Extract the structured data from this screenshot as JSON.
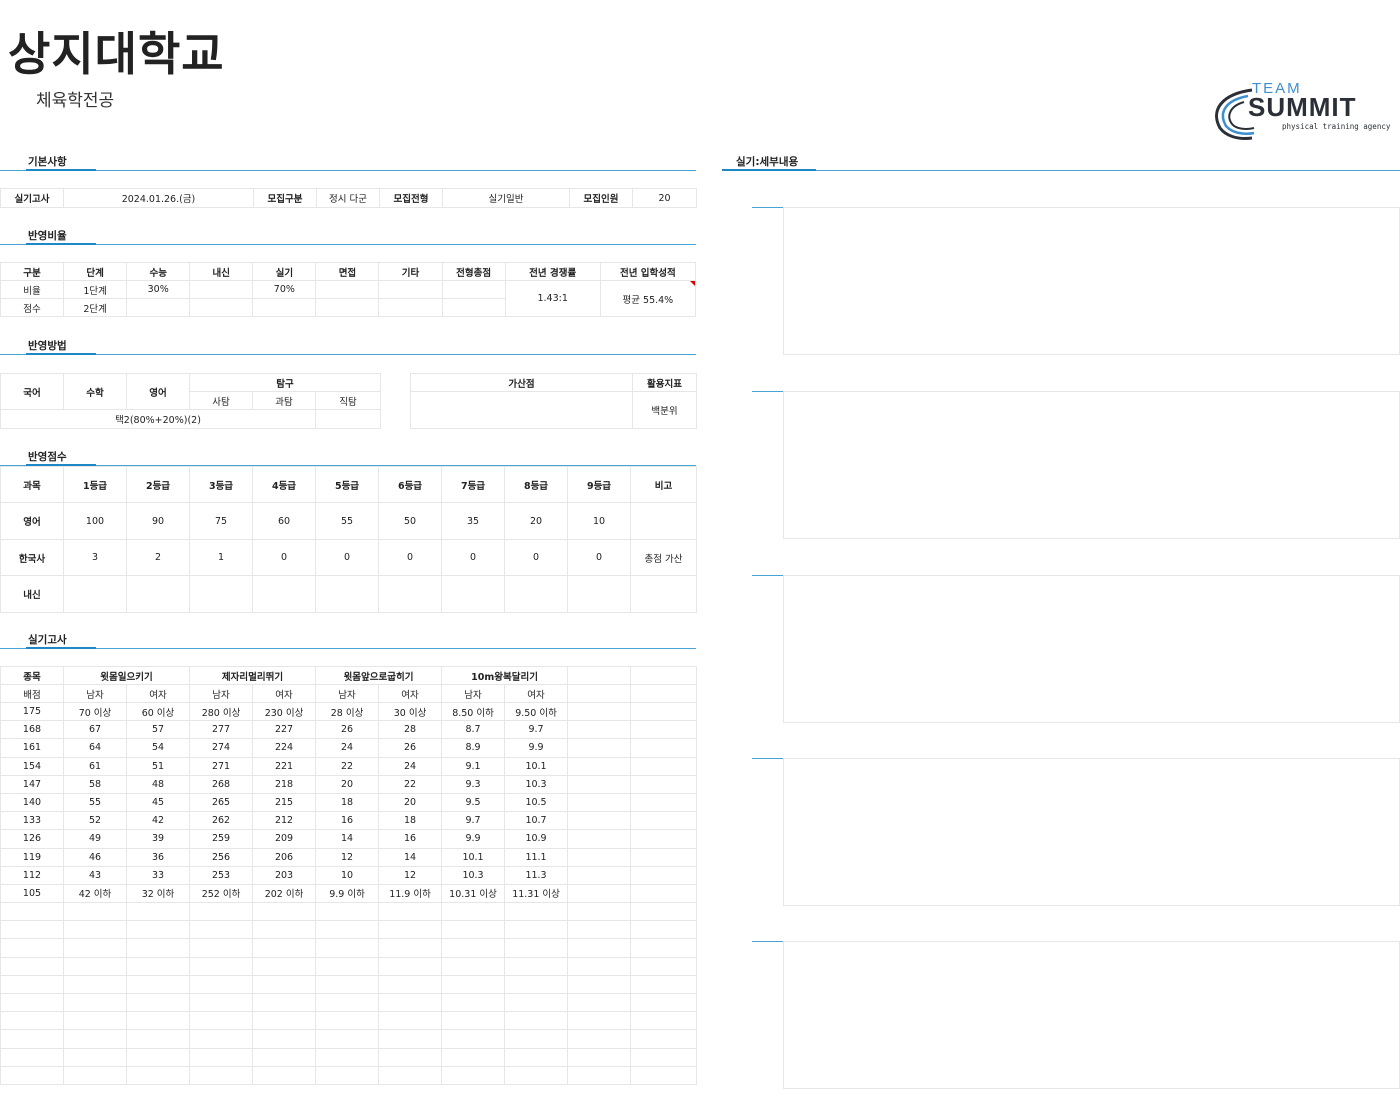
{
  "header": {
    "title": "상지대학교",
    "subtitle": "체육학전공",
    "logo": {
      "line1": "TEAM",
      "line2": "SUMMIT",
      "line3": "physical training agency"
    }
  },
  "sections": {
    "basic": "기본사항",
    "ratio": "반영비율",
    "method": "반영방법",
    "score": "반영점수",
    "practical": "실기고사",
    "detail": "실기:세부내용"
  },
  "basic": {
    "exam_label": "실기고사",
    "exam_date": "2024.01.26.(금)",
    "recruit_type_label": "모집구분",
    "recruit_type": "정시 다군",
    "admission_label": "모집전형",
    "admission": "실기일반",
    "quota_label": "모집인원",
    "quota": "20"
  },
  "ratio": {
    "headers": [
      "구분",
      "단계",
      "수능",
      "내신",
      "실기",
      "면접",
      "기타",
      "전형총점",
      "전년 경쟁률",
      "전년 입학성적"
    ],
    "row1": [
      "비율",
      "1단계",
      "30%",
      "",
      "70%",
      "",
      "",
      ""
    ],
    "row2": [
      "점수",
      "2단계",
      "",
      "",
      "",
      "",
      "",
      ""
    ],
    "competition": "1.43:1",
    "prev_score": "평균 55.4%"
  },
  "method": {
    "korean": "국어",
    "math": "수학",
    "english": "영어",
    "inquiry": "탐구",
    "social": "사탐",
    "science": "과탐",
    "vocational": "직탐",
    "selection": "택2(80%+20%)(2)",
    "bonus": "가산점",
    "index": "활용지표",
    "index_value": "백분위"
  },
  "score": {
    "headers": [
      "과목",
      "1등급",
      "2등급",
      "3등급",
      "4등급",
      "5등급",
      "6등급",
      "7등급",
      "8등급",
      "9등급",
      "비고"
    ],
    "rows": [
      [
        "영어",
        "100",
        "90",
        "75",
        "60",
        "55",
        "50",
        "35",
        "20",
        "10",
        ""
      ],
      [
        "한국사",
        "3",
        "2",
        "1",
        "0",
        "0",
        "0",
        "0",
        "0",
        "0",
        "총점 가산"
      ],
      [
        "내신",
        "",
        "",
        "",
        "",
        "",
        "",
        "",
        "",
        "",
        ""
      ]
    ]
  },
  "practical": {
    "event_label": "종목",
    "events": [
      "윗몸일으키기",
      "제자리멀리뛰기",
      "윗몸앞으로굽히기",
      "10m왕복달리기"
    ],
    "score_label": "배점",
    "male": "남자",
    "female": "여자",
    "rows": [
      [
        "175",
        "70 이상",
        "60 이상",
        "280 이상",
        "230 이상",
        "28 이상",
        "30 이상",
        "8.50 이하",
        "9.50 이하"
      ],
      [
        "168",
        "67",
        "57",
        "277",
        "227",
        "26",
        "28",
        "8.7",
        "9.7"
      ],
      [
        "161",
        "64",
        "54",
        "274",
        "224",
        "24",
        "26",
        "8.9",
        "9.9"
      ],
      [
        "154",
        "61",
        "51",
        "271",
        "221",
        "22",
        "24",
        "9.1",
        "10.1"
      ],
      [
        "147",
        "58",
        "48",
        "268",
        "218",
        "20",
        "22",
        "9.3",
        "10.3"
      ],
      [
        "140",
        "55",
        "45",
        "265",
        "215",
        "18",
        "20",
        "9.5",
        "10.5"
      ],
      [
        "133",
        "52",
        "42",
        "262",
        "212",
        "16",
        "18",
        "9.7",
        "10.7"
      ],
      [
        "126",
        "49",
        "39",
        "259",
        "209",
        "14",
        "16",
        "9.9",
        "10.9"
      ],
      [
        "119",
        "46",
        "36",
        "256",
        "206",
        "12",
        "14",
        "10.1",
        "11.1"
      ],
      [
        "112",
        "43",
        "33",
        "253",
        "203",
        "10",
        "12",
        "10.3",
        "11.3"
      ],
      [
        "105",
        "42 이하",
        "32 이하",
        "252 이하",
        "202 이하",
        "9.9 이하",
        "11.9 이하",
        "10.31 이상",
        "11.31 이상"
      ]
    ]
  },
  "colors": {
    "accent": "#1e88c7",
    "grid": "#e6e6e6",
    "logo_blue": "#3d8fd1",
    "logo_dark": "#2b3038"
  }
}
